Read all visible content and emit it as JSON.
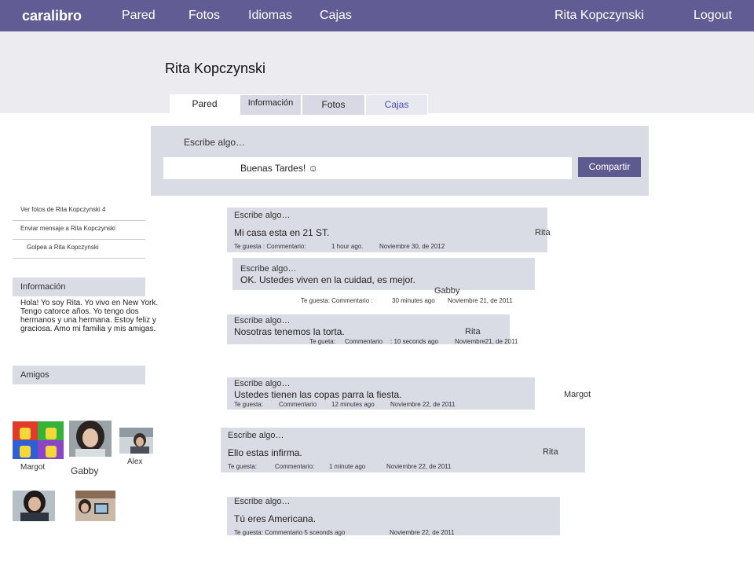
{
  "topbar": {
    "brand": "caralibro",
    "nav": [
      "Pared",
      "Fotos",
      "Idiomas",
      "Cajas"
    ],
    "user": "Rita Kopczynski",
    "logout": "Logout"
  },
  "profile": {
    "name": "Rita Kopczynski",
    "tabs": [
      "Pared",
      "Información",
      "Fotos",
      "Cajas"
    ]
  },
  "composer": {
    "prompt": "Escribe algo…",
    "value": "Buenas Tardes! ☺",
    "share": "Compartir"
  },
  "sidebar": {
    "links": [
      "Ver fotos de Rita Kopczynski 4",
      "Enviar mensaje a Rita Kopczynski",
      "Golpea a Rita Kopczynski"
    ],
    "info_heading": "Información",
    "info_text": "Hola! Yo soy Rita. Yo vivo en New York. Tengo catorce años. Yo tengo dos hermanos y una hermana. Estoy feliz y graciosa. Amo mi familia y  mis amigas.",
    "friends_heading": "Amigos",
    "friends": [
      "Margot",
      "Gabby",
      "Alex"
    ]
  },
  "posts": [
    {
      "label": "Escribe algo…",
      "body": "Mi casa esta en 21 ST.",
      "author": "Rita",
      "meta": [
        "Te guesta : Commentario:",
        "1 hour ago.",
        "Noviembre 30, de 2012"
      ]
    },
    {
      "label": "Escribe algo…",
      "body": "OK. Ustedes viven en la cuidad, es mejor.",
      "author": "Gabby",
      "meta": [
        "Te guesta: Commentario :",
        "30 minutes ago",
        "Noviembre 21, de 2011"
      ]
    },
    {
      "label": "Escribe algo…",
      "body": "Nosotras tenemos la torta.",
      "author": "Rita",
      "meta": [
        "Te gueta:",
        "Commentario",
        ": 10 seconds ago",
        "Noviembre21,  de 2011"
      ]
    },
    {
      "label": "Escribe algo…",
      "body": "Ustedes tienen las copas parra la fiesta.",
      "author": "Margot",
      "meta": [
        "Te guesta:",
        "Commentario",
        "12  minutes ago",
        "Noviembre 22, de 2011"
      ]
    },
    {
      "label": "Escribe algo…",
      "body": "Ello estas infirma.",
      "author": "Rita",
      "meta": [
        "Te guesta:",
        "Commentario:",
        "1 minute ago",
        "Noviembre 22, de 2011"
      ]
    },
    {
      "label": "Escribe algo…",
      "body": "Tú eres Americana.",
      "meta": [
        "Te guesta: Commentario 5 sceonds ago",
        "Noviembre 22, de 2011"
      ]
    }
  ]
}
